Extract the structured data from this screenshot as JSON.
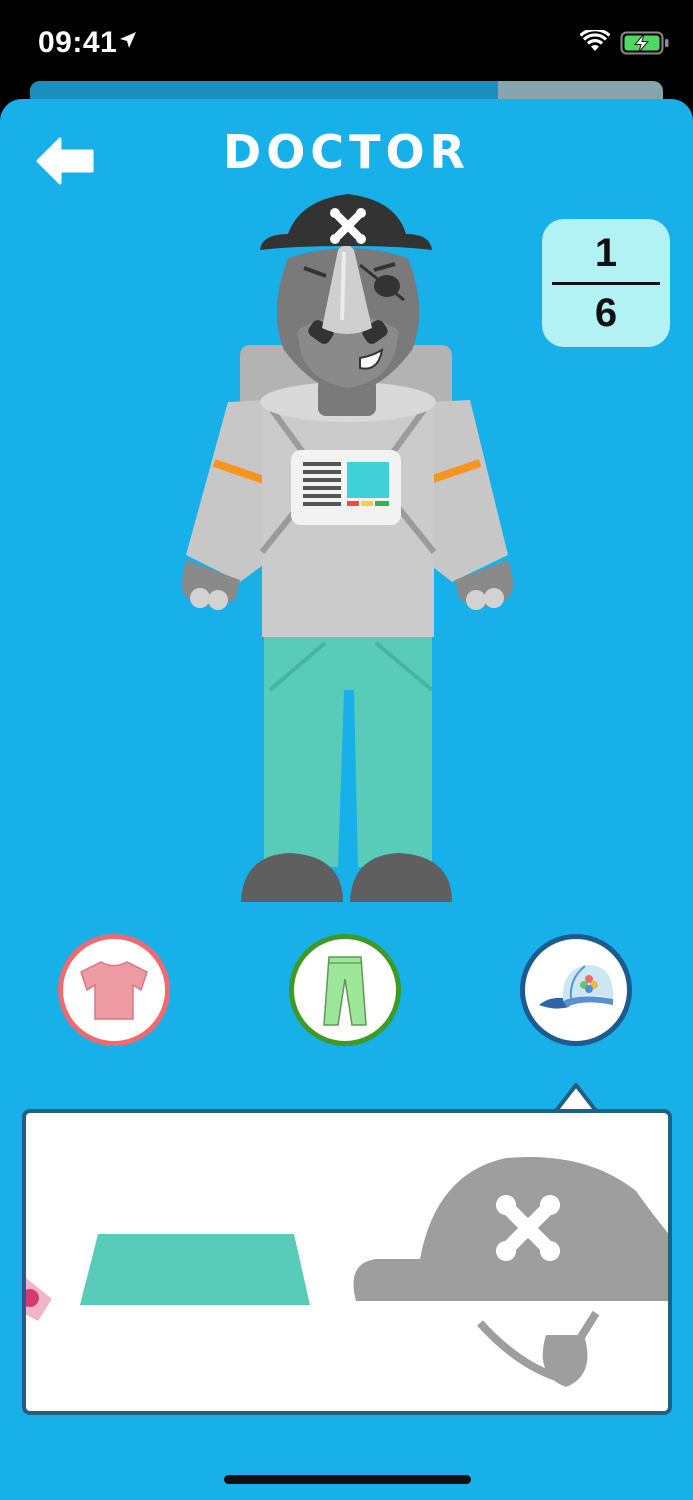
{
  "status_bar": {
    "time": "09:41",
    "icons": [
      "location-arrow-icon",
      "wifi-icon",
      "battery-charging-icon"
    ]
  },
  "progress": {
    "value": 0.74
  },
  "header": {
    "back_icon": "arrow-left-icon",
    "title": "DOCTOR"
  },
  "counter": {
    "numerator": "1",
    "denominator": "6"
  },
  "categories": [
    {
      "name": "shirt",
      "icon": "t-shirt-icon",
      "color": "#f0696f"
    },
    {
      "name": "pants",
      "icon": "pants-icon",
      "color": "#3e9a25"
    },
    {
      "name": "hat",
      "icon": "cap-icon",
      "color": "#1c5a8f",
      "selected": true
    }
  ],
  "tray_items": [
    {
      "name": "pink-item-partial",
      "icon": "pink-accessory-icon"
    },
    {
      "name": "green-brim",
      "icon": "green-hat-brim-icon",
      "color": "#59ccb9"
    },
    {
      "name": "pirate-hat",
      "icon": "pirate-hat-icon",
      "color": "#9e9e9e"
    }
  ],
  "colors": {
    "background": "#17b0e9",
    "counter_bg": "#b3f2f4",
    "tray_border": "#225f82"
  }
}
